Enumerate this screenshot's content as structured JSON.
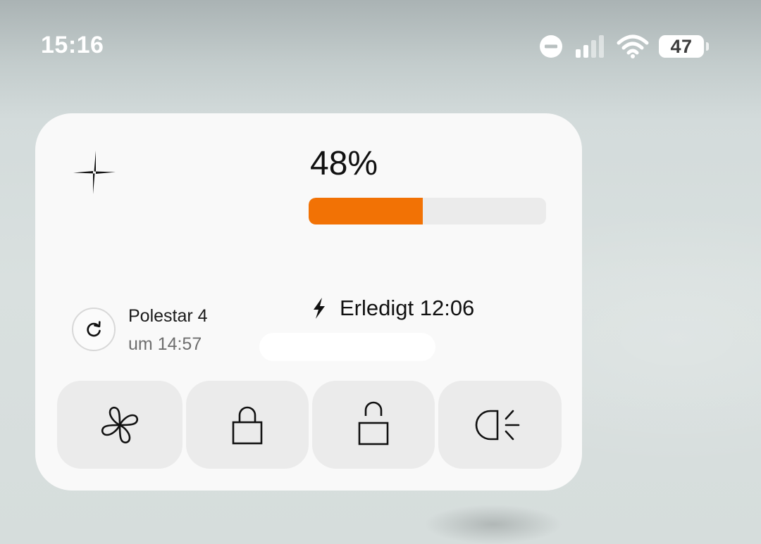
{
  "status_bar": {
    "time": "15:16",
    "icons": [
      "focus-mode-icon",
      "cellular-signal-icon",
      "wifi-icon"
    ],
    "battery_level": "47"
  },
  "widget": {
    "brand_icon": "polestar-logo-icon",
    "charge_percent_label": "48%",
    "charge_level": 0.48,
    "accent_color": "#f27205",
    "track_color": "#ebebeb",
    "car_name": "Polestar 4",
    "last_update": "um 14:57",
    "refresh_icon": "refresh-icon",
    "charging_icon": "lightning-bolt-icon",
    "charge_status": "Erledigt 12:06",
    "controls": [
      {
        "icon": "climate-fan-icon"
      },
      {
        "icon": "lock-icon"
      },
      {
        "icon": "unlock-icon"
      },
      {
        "icon": "headlight-icon"
      }
    ]
  }
}
